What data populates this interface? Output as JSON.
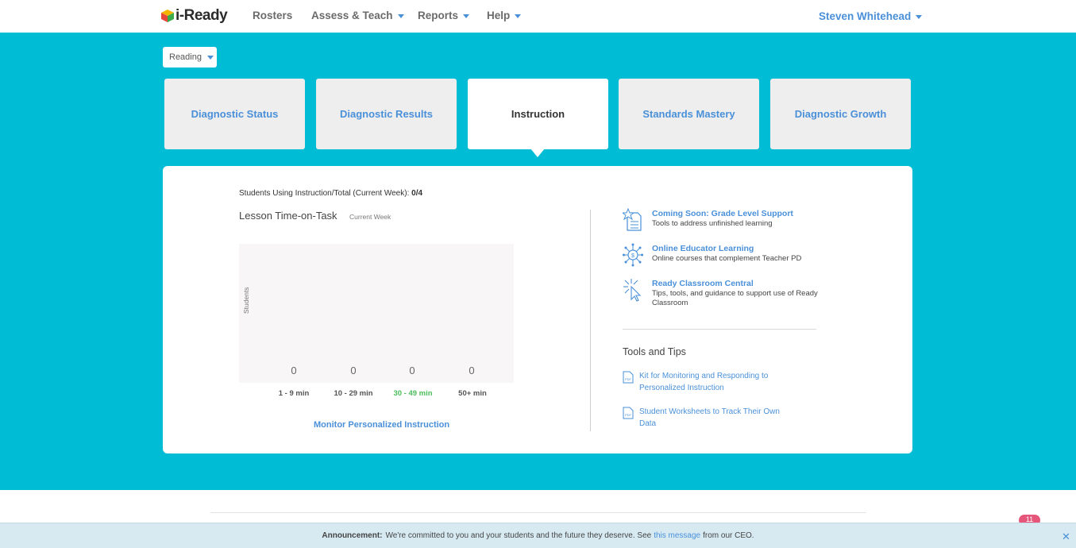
{
  "nav": {
    "logo_text": "i-Ready",
    "items": [
      {
        "label": "Rosters"
      },
      {
        "label": "Assess & Teach"
      },
      {
        "label": "Reports"
      },
      {
        "label": "Help"
      }
    ],
    "user_name": "Steven Whitehead"
  },
  "subject_select": {
    "value": "Reading"
  },
  "tabs": [
    {
      "label": "Diagnostic Status"
    },
    {
      "label": "Diagnostic Results"
    },
    {
      "label": "Instruction"
    },
    {
      "label": "Standards Mastery"
    },
    {
      "label": "Diagnostic Growth"
    }
  ],
  "card": {
    "students_using_label": "Students Using Instruction/Total (Current Week):",
    "students_using_value": "0/4",
    "chart_title": "Lesson Time-on-Task",
    "chart_period": "Current Week",
    "monitor_link": "Monitor Personalized Instruction"
  },
  "chart_data": {
    "type": "bar",
    "ylabel": "Students",
    "categories": [
      "1 - 9 min",
      "10 - 29 min",
      "30 - 49 min",
      "50+ min"
    ],
    "values": [
      0,
      0,
      0,
      0
    ],
    "highlight_category": "30 - 49 min",
    "highlight_color": "#4cbd5a"
  },
  "resources": [
    {
      "title": "Coming Soon: Grade Level Support",
      "desc": "Tools to address unfinished learning",
      "icon": "document-star-icon"
    },
    {
      "title": "Online Educator Learning",
      "desc": "Online courses that complement Teacher PD",
      "icon": "network-hub-icon"
    },
    {
      "title": "Ready Classroom Central",
      "desc": "Tips, tools, and guidance to support use of Ready Classroom",
      "icon": "cursor-click-icon"
    }
  ],
  "tools": {
    "heading": "Tools and Tips",
    "items": [
      {
        "label": "Kit for Monitoring and Responding to Personalized Instruction",
        "icon": "pdf-icon"
      },
      {
        "label": "Student Worksheets to Track Their Own Data",
        "icon": "pdf-icon"
      }
    ]
  },
  "notification_count": "11",
  "announcement": {
    "label": "Announcement:",
    "text_before": "We're committed to you and your students and the future they deserve. See",
    "link": "this message",
    "text_after": "from our CEO."
  },
  "colors": {
    "teal": "#00bcd4",
    "link_blue": "#4a90d9",
    "green": "#4cbd5a",
    "badge_pink": "#e5567a"
  }
}
